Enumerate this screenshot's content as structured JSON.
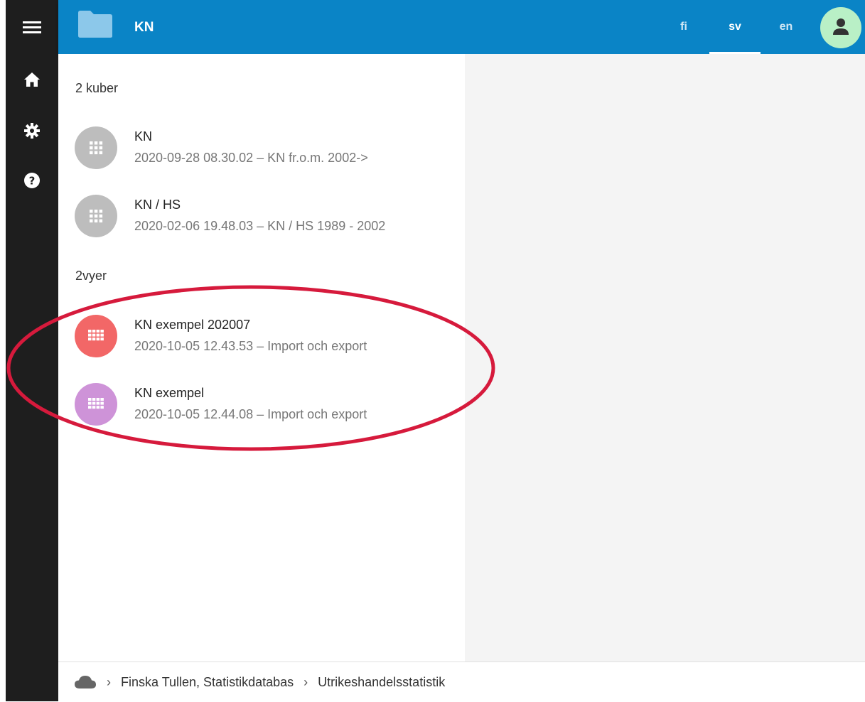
{
  "header": {
    "title": "KN"
  },
  "languages": [
    {
      "code": "fi",
      "active": false
    },
    {
      "code": "sv",
      "active": true
    },
    {
      "code": "en",
      "active": false
    }
  ],
  "sidebar": {
    "icons": [
      "menu-icon",
      "home-icon",
      "gear-icon",
      "help-icon"
    ]
  },
  "cubes": {
    "heading": "2 kuber",
    "items": [
      {
        "title": "KN",
        "subtitle": "2020-09-28 08.30.02 – KN fr.o.m. 2002->",
        "color": "#bdbdbd",
        "icon": "grid-icon"
      },
      {
        "title": "KN / HS",
        "subtitle": "2020-02-06 19.48.03 – KN / HS 1989 - 2002",
        "color": "#bdbdbd",
        "icon": "grid-icon"
      }
    ]
  },
  "views": {
    "heading": "2vyer",
    "items": [
      {
        "title": "KN exempel 202007",
        "subtitle": "2020-10-05 12.43.53 – Import och export",
        "color": "#f26767",
        "icon": "table-icon"
      },
      {
        "title": "KN exempel",
        "subtitle": "2020-10-05 12.44.08 – Import och export",
        "color": "#ce93d8",
        "icon": "table-icon"
      }
    ]
  },
  "breadcrumb": {
    "icon": "cloud-icon",
    "items": [
      "Finska Tullen, Statistikdatabas",
      "Utrikeshandelsstatistik"
    ]
  },
  "colors": {
    "topbar": "#0a84c6",
    "sidebar": "#1e1e1e",
    "highlight": "#d61a3c",
    "avatar": "#b9f0c6"
  }
}
